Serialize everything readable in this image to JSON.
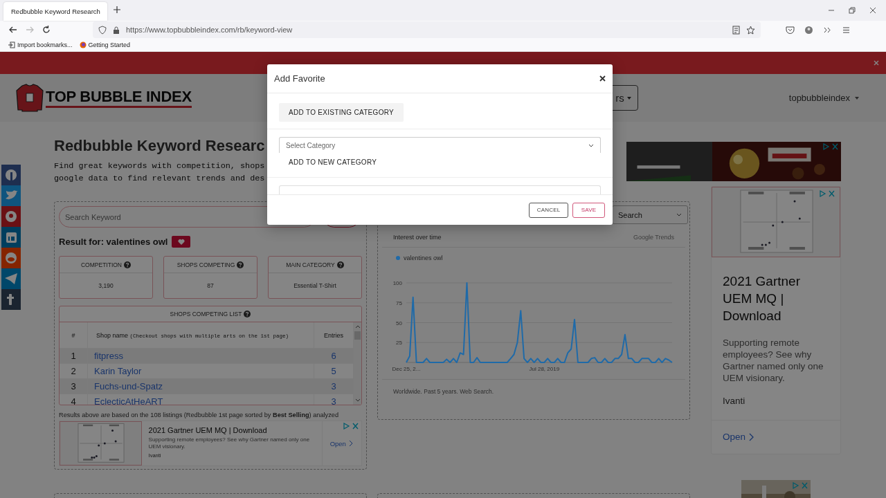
{
  "browser": {
    "tab_title": "Redbubble Keyword Research",
    "url": "https://www.topbubbleindex.com/rb/keyword-view",
    "bookmarks": [
      "Import bookmarks...",
      "Getting Started"
    ]
  },
  "header": {
    "nav_button_partial": "rs",
    "user_menu": "topbubbleindex",
    "logo_text": "TOP BUBBLE INDEX"
  },
  "intro": {
    "title": "Redbubble Keyword Researc",
    "description_lines": [
      "Find great keywords with competition, shops",
      "google data to find relevant trends and des"
    ]
  },
  "keyword_panel": {
    "search": {
      "placeholder": "Search Keyword"
    },
    "result_label": "Result for: valentines owl",
    "stats": [
      {
        "label": "COMPETITION",
        "value": "3,190"
      },
      {
        "label": "SHOPS COMPETING",
        "value": "87"
      },
      {
        "label": "MAIN CATEGORY",
        "value": "Essential T-Shirt"
      }
    ],
    "shops_list": {
      "title": "SHOPS COMPETING LIST",
      "columns": [
        "#",
        "Shop name",
        "Entries"
      ],
      "column_note": "(Checkout shops with multiple arts on the 1st page)",
      "rows": [
        {
          "rank": "1",
          "shop": "fitpress",
          "entries": "6"
        },
        {
          "rank": "2",
          "shop": "Karin Taylor",
          "entries": "5"
        },
        {
          "rank": "3",
          "shop": "Fuchs-und-Spatz",
          "entries": "3"
        },
        {
          "rank": "4",
          "shop": "EclecticAtHeART",
          "entries": "3"
        }
      ]
    },
    "note": "Results above are based on the 108 listings (Redbubble 1st page sorted by **Best Selling**) analyzed",
    "ad": {
      "title": "2021 Gartner UEM MQ | Download",
      "description": "Supporting remote employees? See why Gartner named only one UEM visionary.",
      "advertiser": "Ivanti",
      "action": "Open"
    }
  },
  "trends_panel": {
    "search_type": "Search",
    "title": "Interest over time",
    "source": "Google Trends",
    "footer": "Worldwide. Past 5 years. Web Search.",
    "chart_data": {
      "type": "line",
      "grid": true,
      "categories": [
        "Dec 25, 2...",
        null,
        null,
        null,
        null,
        null,
        null,
        null,
        null,
        null,
        null,
        null,
        null,
        null,
        null,
        null,
        null,
        null,
        null,
        null,
        null,
        null,
        null,
        null,
        null,
        null,
        null,
        null,
        null,
        null,
        null,
        null,
        null,
        null,
        null,
        null,
        null,
        null,
        null,
        null,
        null,
        "Jul 28, 2019",
        null,
        null,
        null,
        null,
        null,
        null,
        null,
        null,
        null,
        null,
        null,
        null,
        null,
        null,
        null,
        null,
        null,
        null,
        null,
        null,
        null,
        null,
        null,
        null,
        null,
        null,
        null,
        null,
        null,
        null,
        null,
        null,
        null,
        null,
        null,
        null,
        null,
        null
      ],
      "ylim": [
        0,
        100
      ],
      "yticks": [
        25,
        50,
        75,
        100
      ],
      "series": [
        {
          "name": "valentines owl",
          "color": "#1f6aa8",
          "values": [
            0,
            8,
            82,
            0,
            0,
            0,
            5,
            0,
            0,
            0,
            0,
            0,
            4,
            0,
            5,
            0,
            12,
            10,
            100,
            0,
            0,
            6,
            0,
            0,
            0,
            0,
            0,
            0,
            0,
            0,
            0,
            5,
            10,
            25,
            65,
            5,
            0,
            5,
            0,
            5,
            0,
            0,
            5,
            0,
            0,
            5,
            0,
            0,
            12,
            17,
            54,
            0,
            0,
            0,
            0,
            5,
            6,
            0,
            0,
            5,
            0,
            0,
            5,
            5,
            10,
            35,
            5,
            5,
            0,
            0,
            5,
            5,
            5,
            0,
            0,
            5,
            0,
            5,
            3,
            0
          ]
        }
      ]
    }
  },
  "side_ad": {
    "title": "2021 Gartner UEM MQ | Download",
    "description": "Supporting remote employees? See why Gartner named only one UEM visionary.",
    "advertiser": "Ivanti",
    "action": "Open"
  },
  "modal": {
    "title": "Add Favorite",
    "existing_button": "ADD TO EXISTING CATEGORY",
    "category_select": {
      "placeholder": "Select Category"
    },
    "new_category_label": "ADD TO NEW CATEGORY",
    "buttons": [
      {
        "label": "CANCEL",
        "kind": "secondary"
      },
      {
        "label": "SAVE",
        "kind": "primary"
      }
    ]
  }
}
